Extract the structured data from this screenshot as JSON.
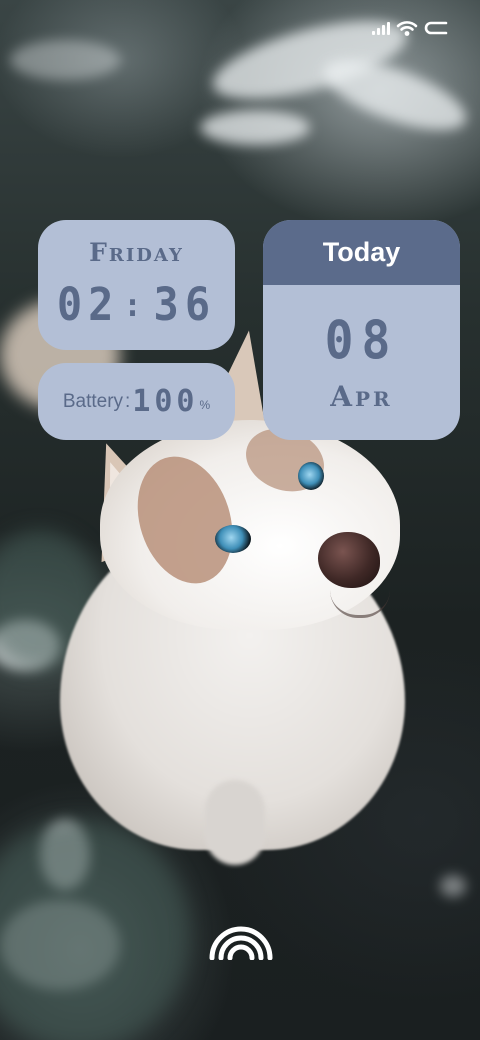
{
  "status_bar": {
    "icons": [
      "signal-icon",
      "wifi-icon",
      "battery-icon"
    ]
  },
  "widgets": {
    "day": {
      "name": "Friday",
      "time_hours": "02",
      "time_separator": ":",
      "time_minutes": "36"
    },
    "battery": {
      "label": "Battery",
      "separator": ":",
      "value": "100",
      "unit": "%",
      "level": 1.0
    },
    "date": {
      "header": "Today",
      "day": "08",
      "month": "Apr"
    }
  },
  "bottom": {
    "icon": "nfc-icon"
  },
  "colors": {
    "widget_bg": "#b3bfd6",
    "widget_text": "#5a6a89",
    "header_bg": "#5b6b8b",
    "header_text": "#ffffff"
  }
}
